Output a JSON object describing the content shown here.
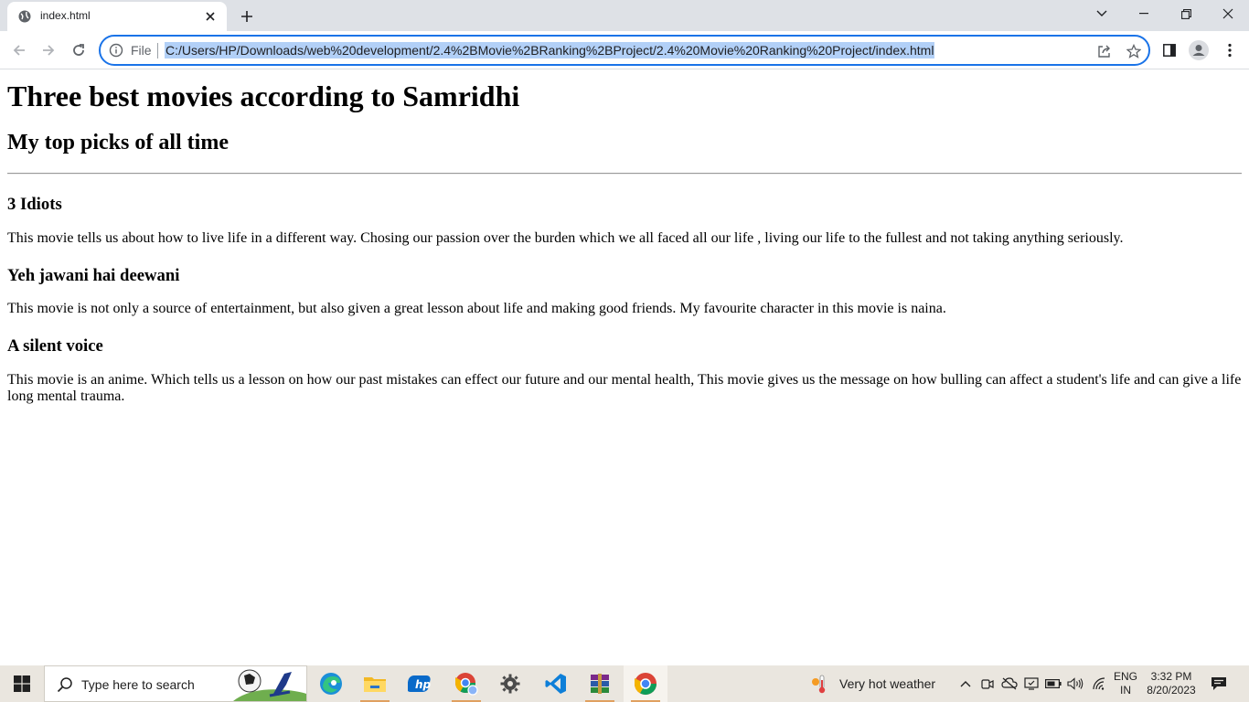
{
  "browser": {
    "tab": {
      "title": "index.html"
    },
    "address": {
      "scheme_label": "File",
      "url": "C:/Users/HP/Downloads/web%20development/2.4%2BMovie%2BRanking%2BProject/2.4%20Movie%20Ranking%20Project/index.html"
    },
    "accent_color": "#1a73e8",
    "selection_color": "#b2d0f7"
  },
  "page": {
    "heading": "Three best movies according to Samridhi",
    "subheading": "My top picks of all time",
    "movies": [
      {
        "title": "3 Idiots",
        "description": "This movie tells us about how to live life in a different way. Chosing our passion over the burden which we all faced all our life , living our life to the fullest and not taking anything seriously."
      },
      {
        "title": "Yeh jawani hai deewani",
        "description": "This movie is not only a source of entertainment, but also given a great lesson about life and making good friends. My favourite character in this movie is naina."
      },
      {
        "title": "A silent voice",
        "description": "This movie is an anime. Which tells us a lesson on how our past mistakes can effect our future and our mental health, This movie gives us the message on how bulling can affect a student's life and can give a life long mental trauma."
      }
    ]
  },
  "taskbar": {
    "search_placeholder": "Type here to search",
    "weather_text": "Very hot weather",
    "language_line1": "ENG",
    "language_line2": "IN",
    "time": "3:32 PM",
    "date": "8/20/2023",
    "apps": [
      "edge-icon",
      "file-explorer-icon",
      "hp-icon",
      "chrome-profile-icon",
      "settings-icon",
      "vscode-icon",
      "winrar-icon",
      "chrome-icon"
    ]
  }
}
